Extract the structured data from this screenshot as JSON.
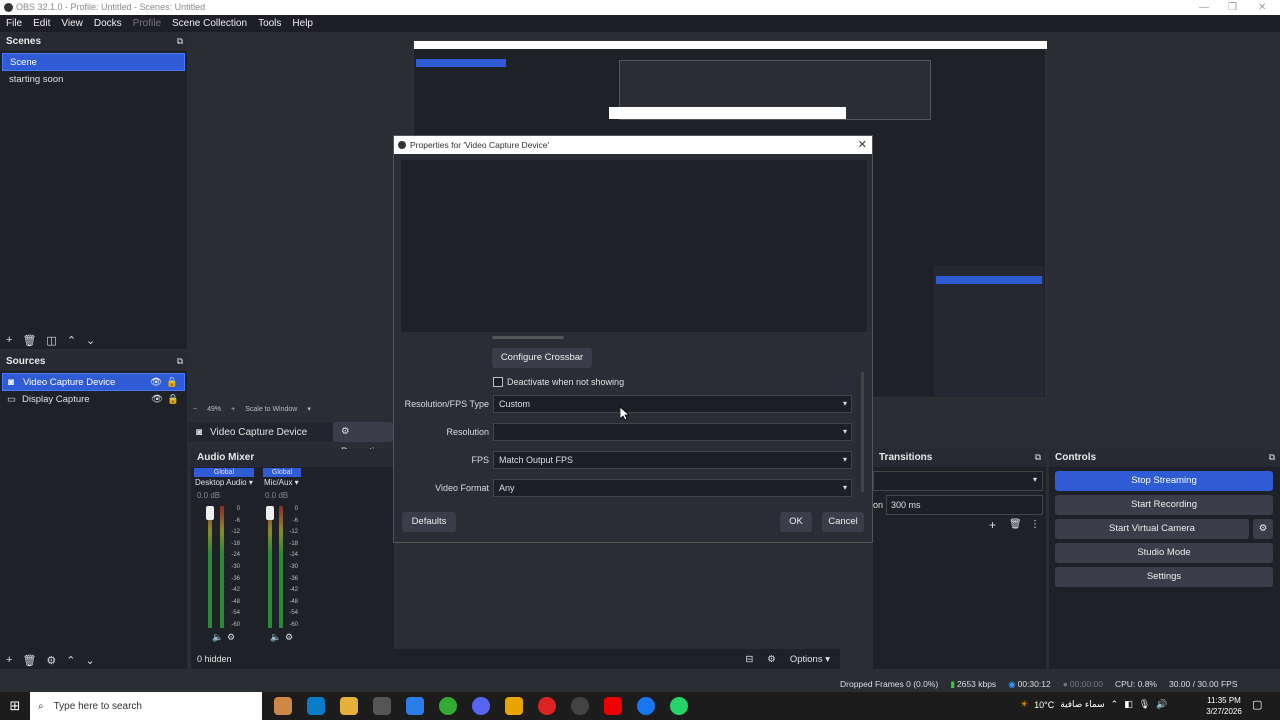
{
  "window": {
    "title": "OBS 32.1.0 - Profile: Untitled - Scenes: Untitled"
  },
  "menu": [
    "File",
    "Edit",
    "View",
    "Docks",
    "Profile",
    "Scene Collection",
    "Tools",
    "Help"
  ],
  "scenes": {
    "title": "Scenes",
    "items": [
      "Scene",
      "starting soon"
    ]
  },
  "sources": {
    "title": "Sources",
    "items": [
      "Video Capture Device",
      "Display Capture"
    ]
  },
  "preview_bar": {
    "zoom": "49%",
    "scale": "Scale to Window"
  },
  "context_bar": {
    "source": "Video Capture Device",
    "properties": "Properties"
  },
  "mixer": {
    "title": "Audio Mixer",
    "channels": [
      {
        "global": "Global",
        "name": "Desktop Audio",
        "db": "0.0 dB"
      },
      {
        "global": "Global",
        "name": "Mic/Aux",
        "db": "0.0 dB"
      }
    ],
    "ticks": [
      "0",
      "-6",
      "-12",
      "-18",
      "-24",
      "-30",
      "-36",
      "-42",
      "-48",
      "-54",
      "-60"
    ],
    "hidden": "0 hidden",
    "options": "Options"
  },
  "dialog": {
    "title": "Properties for 'Video Capture Device'",
    "configure": "Configure Crossbar",
    "deactivate": "Deactivate when not showing",
    "fields": [
      {
        "label": "Resolution/FPS Type",
        "value": "Custom"
      },
      {
        "label": "Resolution",
        "value": ""
      },
      {
        "label": "FPS",
        "value": "Match Output FPS"
      },
      {
        "label": "Video Format",
        "value": "Any"
      }
    ],
    "defaults": "Defaults",
    "ok": "OK",
    "cancel": "Cancel"
  },
  "transitions": {
    "title": "Transitions",
    "duration_label": "on",
    "duration": "300 ms"
  },
  "controls": {
    "title": "Controls",
    "buttons": [
      "Stop Streaming",
      "Start Recording",
      "Start Virtual Camera",
      "Studio Mode",
      "Settings"
    ]
  },
  "status": {
    "dropped": "Dropped Frames 0 (0.0%)",
    "kbps": "2653 kbps",
    "stream_time": "00:30:12",
    "rec_time": "00:00:00",
    "cpu": "CPU: 0.8%",
    "fps": "30.00 / 30.00 FPS"
  },
  "taskbar": {
    "search": "Type here to search",
    "weather": "10°C",
    "weather_text": "سماء صافية",
    "time": "11:35 PM",
    "date": "3/27/2026"
  },
  "colors": {
    "accent": "#2f5bd4"
  }
}
